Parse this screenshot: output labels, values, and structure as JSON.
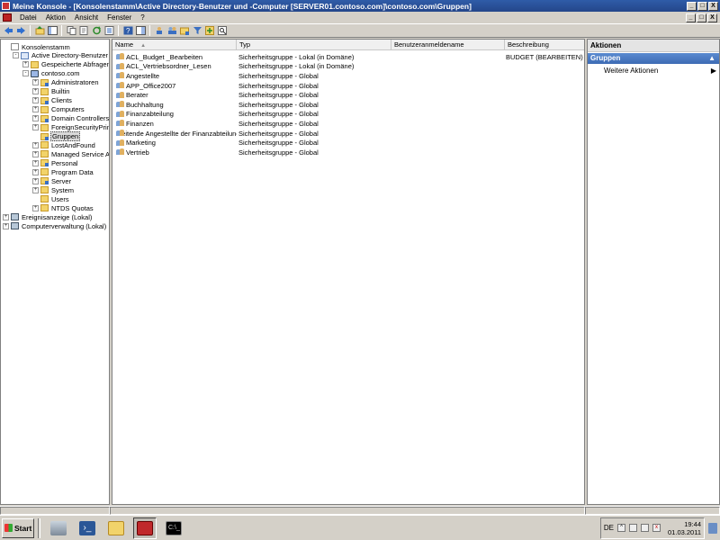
{
  "window": {
    "title": "Meine Konsole - [Konsolenstamm\\Active Directory-Benutzer und -Computer [SERVER01.contoso.com]\\contoso.com\\Gruppen]",
    "min_label": "_",
    "max_label": "□",
    "close_label": "X"
  },
  "menu": {
    "items": [
      "Datei",
      "Aktion",
      "Ansicht",
      "Fenster",
      "?"
    ]
  },
  "toolbar": {
    "buttons": [
      "back-icon",
      "forward-icon",
      "up-folder-icon",
      "show-hide-tree-icon",
      "copy-icon",
      "export-icon",
      "refresh-icon",
      "properties-icon",
      "help-icon",
      "console-tree-icon",
      "new-user-icon",
      "new-group-icon",
      "new-ou-icon",
      "filter-icon",
      "add-to-group-icon",
      "find-icon"
    ]
  },
  "tree": {
    "items": [
      {
        "label": "Konsolenstamm",
        "level": 0,
        "expander": "",
        "icon": "root"
      },
      {
        "label": "Active Directory-Benutzer und",
        "level": 1,
        "expander": "-",
        "icon": "ad"
      },
      {
        "label": "Gespeicherte Abfragen",
        "level": 2,
        "expander": "+",
        "icon": "folder"
      },
      {
        "label": "contoso.com",
        "level": 2,
        "expander": "-",
        "icon": "domain"
      },
      {
        "label": "Administratoren",
        "level": 3,
        "expander": "+",
        "icon": "ou"
      },
      {
        "label": "Builtin",
        "level": 3,
        "expander": "+",
        "icon": "folder"
      },
      {
        "label": "Clients",
        "level": 3,
        "expander": "+",
        "icon": "ou"
      },
      {
        "label": "Computers",
        "level": 3,
        "expander": "+",
        "icon": "folder"
      },
      {
        "label": "Domain Controllers",
        "level": 3,
        "expander": "+",
        "icon": "ou"
      },
      {
        "label": "ForeignSecurityPrincipa",
        "level": 3,
        "expander": "+",
        "icon": "folder"
      },
      {
        "label": "Gruppen",
        "level": 3,
        "expander": "",
        "icon": "ou",
        "selected": true
      },
      {
        "label": "LostAndFound",
        "level": 3,
        "expander": "+",
        "icon": "folder"
      },
      {
        "label": "Managed Service Accou",
        "level": 3,
        "expander": "+",
        "icon": "folder"
      },
      {
        "label": "Personal",
        "level": 3,
        "expander": "+",
        "icon": "ou"
      },
      {
        "label": "Program Data",
        "level": 3,
        "expander": "+",
        "icon": "folder"
      },
      {
        "label": "Server",
        "level": 3,
        "expander": "+",
        "icon": "ou"
      },
      {
        "label": "System",
        "level": 3,
        "expander": "+",
        "icon": "folder"
      },
      {
        "label": "Users",
        "level": 3,
        "expander": "",
        "icon": "folder"
      },
      {
        "label": "NTDS Quotas",
        "level": 3,
        "expander": "+",
        "icon": "folder"
      },
      {
        "label": "Ereignisanzeige (Lokal)",
        "level": 0,
        "expander": "+",
        "icon": "comp"
      },
      {
        "label": "Computerverwaltung (Lokal)",
        "level": 0,
        "expander": "+",
        "icon": "comp"
      }
    ]
  },
  "list": {
    "columns": [
      "Name",
      "Typ",
      "Benutzeranmeldename",
      "Beschreibung"
    ],
    "sort_indicator": "▲",
    "rows": [
      {
        "name": "ACL_Budget _Bearbeiten",
        "typ": "Sicherheitsgruppe - Lokal (in Domäne)",
        "user": "",
        "desc": "BUDGET (BEARBEITEN)"
      },
      {
        "name": "ACL_Vertriebsordner_Lesen",
        "typ": "Sicherheitsgruppe - Lokal (in Domäne)",
        "user": "",
        "desc": ""
      },
      {
        "name": "Angestellte",
        "typ": "Sicherheitsgruppe - Global",
        "user": "",
        "desc": ""
      },
      {
        "name": "APP_Office2007",
        "typ": "Sicherheitsgruppe - Global",
        "user": "",
        "desc": ""
      },
      {
        "name": "Berater",
        "typ": "Sicherheitsgruppe - Global",
        "user": "",
        "desc": ""
      },
      {
        "name": "Buchhaltung",
        "typ": "Sicherheitsgruppe - Global",
        "user": "",
        "desc": ""
      },
      {
        "name": "Finanzabteilung",
        "typ": "Sicherheitsgruppe - Global",
        "user": "",
        "desc": ""
      },
      {
        "name": "Finanzen",
        "typ": "Sicherheitsgruppe - Global",
        "user": "",
        "desc": ""
      },
      {
        "name": "Leitende Angestellte der Finanzabteilung",
        "typ": "Sicherheitsgruppe - Global",
        "user": "",
        "desc": ""
      },
      {
        "name": "Marketing",
        "typ": "Sicherheitsgruppe - Global",
        "user": "",
        "desc": ""
      },
      {
        "name": "Vertrieb",
        "typ": "Sicherheitsgruppe - Global",
        "user": "",
        "desc": ""
      }
    ]
  },
  "actions": {
    "title": "Aktionen",
    "section": "Gruppen",
    "section_caret": "▲",
    "item": "Weitere Aktionen",
    "item_arrow": "▶"
  },
  "taskbar": {
    "start_label": "Start",
    "apps": [
      "server-manager-icon",
      "powershell-icon",
      "explorer-icon",
      "toolbox-icon",
      "cmd-icon"
    ],
    "lang": "DE",
    "time": "19:44",
    "date": "01.03.2011"
  }
}
